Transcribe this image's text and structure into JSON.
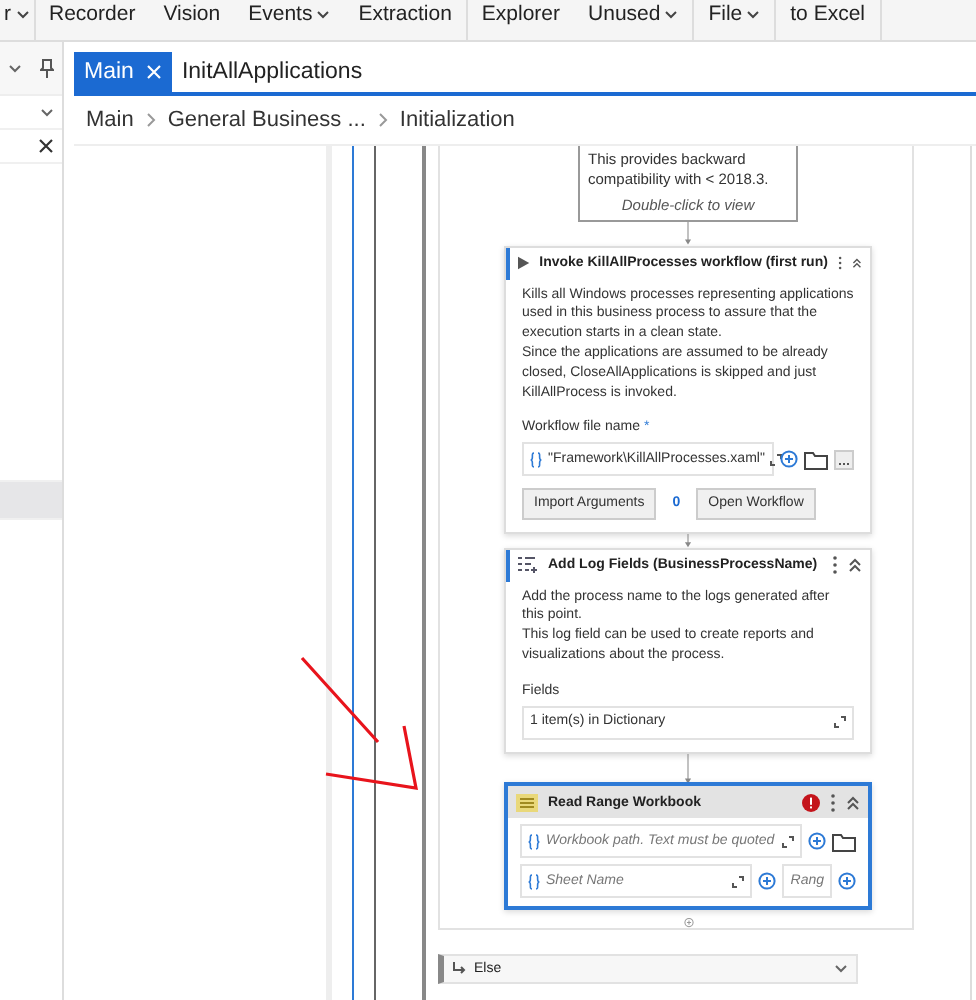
{
  "ribbon": [
    {
      "label": "r",
      "caret": true
    },
    {
      "label": "Recorder",
      "caret": false
    },
    {
      "label": "Vision",
      "caret": false
    },
    {
      "label": "Events",
      "caret": true
    },
    {
      "label": "Extraction",
      "caret": false
    },
    {
      "label": "Explorer",
      "caret": false
    },
    {
      "label": "Unused",
      "caret": true
    },
    {
      "label": "File",
      "caret": true
    },
    {
      "label": "to Excel",
      "caret": false
    }
  ],
  "left_panel": {
    "rows": [
      {
        "selected": false
      },
      {
        "selected": true
      }
    ]
  },
  "tabs": [
    {
      "label": "Main",
      "selected": true
    },
    {
      "label": "InitAllApplications",
      "selected": false
    }
  ],
  "breadcrumb": [
    "Main",
    "General Business ...",
    "Initialization"
  ],
  "annotation_card": {
    "text": "This provides backward compatibility with < 2018.3.",
    "hint": "Double-click to view"
  },
  "activities": [
    {
      "kind": "invoke",
      "title": "Invoke KillAllProcesses workflow (first run)",
      "description": [
        "Kills all Windows processes representing applications used in this business process to assure that the execution starts in a clean state.",
        "Since the applications are assumed to be already closed, CloseAllApplications is skipped and just KillAllProcess is invoked."
      ],
      "field_label": "Workflow file name",
      "required_mark": "*",
      "field_value": "\"Framework\\KillAllProcesses.xaml\"",
      "import_label": "Import Arguments",
      "import_count": "0",
      "open_label": "Open Workflow",
      "selected": false,
      "error": false
    },
    {
      "kind": "log",
      "title": "Add Log Fields (BusinessProcessName)",
      "description": [
        "Add the process name to the logs generated after this point.",
        "This log field can be used to create reports and visualizations about the process."
      ],
      "field_label": "Fields",
      "field_value": "1 item(s) in Dictionary",
      "selected": false,
      "error": false
    },
    {
      "kind": "read_range",
      "title": "Read Range Workbook",
      "path_placeholder": "Workbook path. Text must be quoted",
      "sheet_placeholder": "Sheet Name",
      "range_placeholder": "Rang",
      "selected": true,
      "error": true
    }
  ],
  "else_label": "Else"
}
